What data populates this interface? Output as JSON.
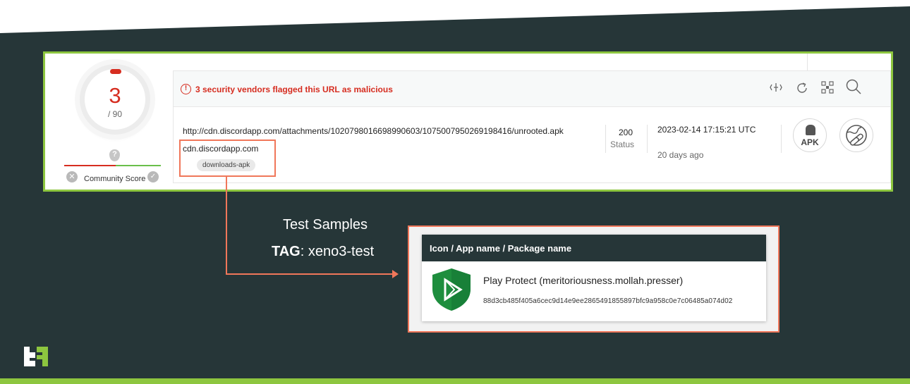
{
  "colors": {
    "background": "#263638",
    "accent_green": "#8dc63f",
    "highlight": "#f0775a",
    "malicious_red": "#d62d20"
  },
  "vt": {
    "score": "3",
    "total": "/ 90",
    "community_label": "Community Score",
    "banner_text": "3 security vendors flagged this URL as malicious",
    "url": "http://cdn.discordapp.com/attachments/1020798016698990603/1075007950269198416/unrooted.apk",
    "domain": "cdn.discordapp.com",
    "tag": "downloads-apk",
    "status_code": "200",
    "status_label": "Status",
    "date": "2023-02-14 17:15:21 UTC",
    "relative_date": "20 days ago",
    "apk_label": "APK",
    "toolbar_icons": [
      "compare-icon",
      "reanalyze-icon",
      "graph-icon",
      "search-icon"
    ]
  },
  "annotation": {
    "title": "Test Samples",
    "tag_key": "TAG",
    "tag_value": ": xeno3-test"
  },
  "sample": {
    "header": "Icon / App name / Package name",
    "app_name": "Play Protect (meritoriousness.mollah.presser)",
    "hash": "88d3cb485f405a6cec9d14e9ee2865491855897bfc9a958c0e7c06485a074d02",
    "icon": "play-protect-icon"
  }
}
